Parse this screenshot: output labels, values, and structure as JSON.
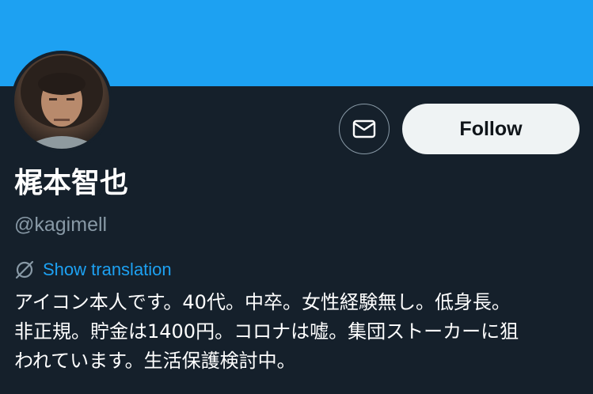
{
  "profile": {
    "display_name": "梶本智也",
    "handle": "@kagimell",
    "translate_label": "Show translation",
    "bio_lines": [
      "アイコン本人です。40代。中卒。女性経験無し。低身長。",
      "非正規。貯金は1400円。コロナは嘘。集団ストーカーに狙",
      "われています。生活保護検討中。"
    ]
  },
  "actions": {
    "follow_label": "Follow",
    "message_icon": "envelope-icon"
  },
  "colors": {
    "banner": "#1da1f2",
    "background": "#15202b",
    "link": "#1da1f2",
    "muted": "#8899a6",
    "follow_bg": "#eff3f4"
  }
}
